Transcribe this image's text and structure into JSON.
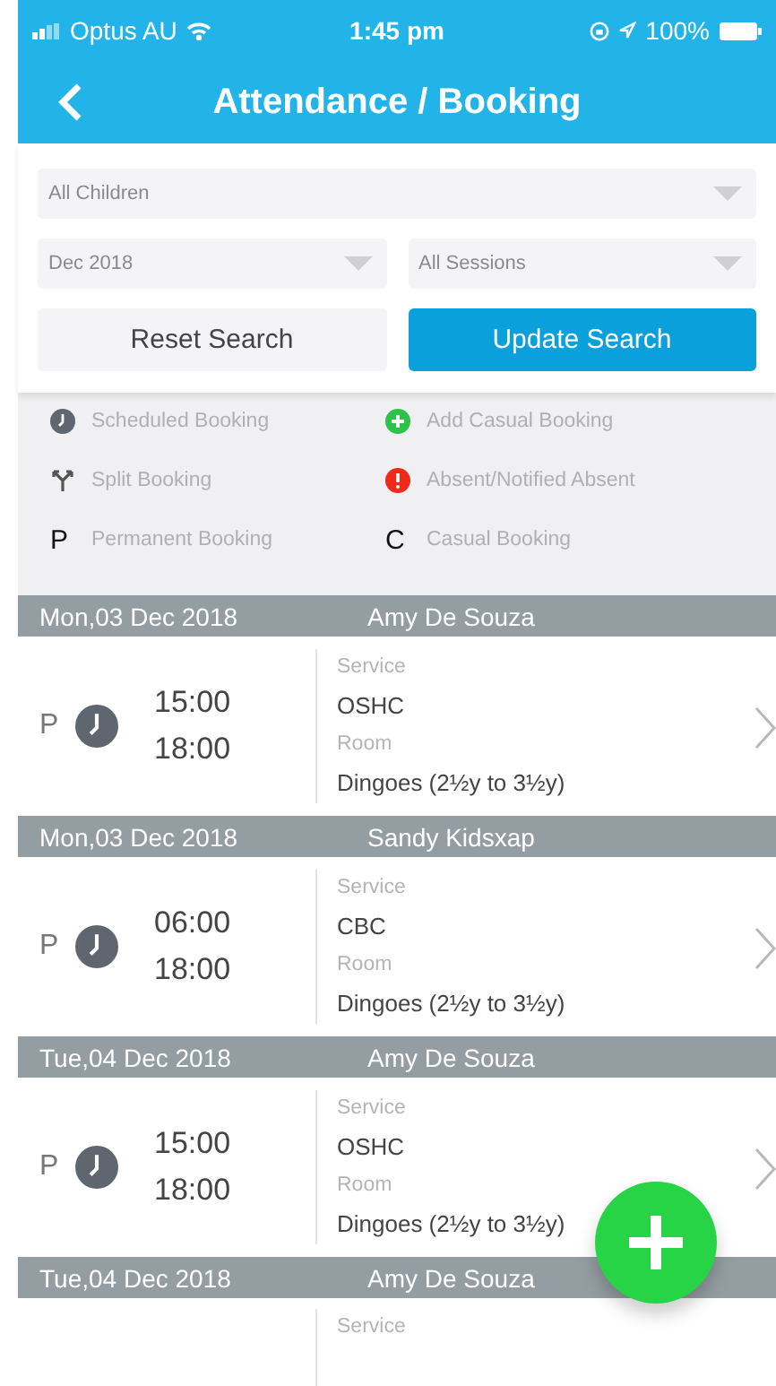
{
  "status_bar": {
    "carrier": "Optus AU",
    "time": "1:45 pm",
    "battery": "100%"
  },
  "header": {
    "title": "Attendance / Booking"
  },
  "filters": {
    "children": "All Children",
    "month": "Dec 2018",
    "sessions": "All Sessions"
  },
  "buttons": [
    {
      "label": "Reset Search",
      "kind": "secondary"
    },
    {
      "label": "Update Search",
      "kind": "primary"
    }
  ],
  "legend": [
    {
      "kind": "clock",
      "label": "Scheduled Booking"
    },
    {
      "kind": "add",
      "label": "Add Casual Booking"
    },
    {
      "kind": "split",
      "label": "Split Booking"
    },
    {
      "kind": "absent",
      "label": "Absent/Notified Absent"
    },
    {
      "kind": "letter",
      "mark": "P",
      "label": "Permanent Booking"
    },
    {
      "kind": "letter",
      "mark": "C",
      "label": "Casual Booking"
    }
  ],
  "bookings": [
    {
      "date": "Mon,03 Dec 2018",
      "child": "Amy De Souza",
      "type": "P",
      "start": "15:00",
      "end": "18:00",
      "service_label": "Service",
      "service": "OSHC",
      "room_label": "Room",
      "room": "Dingoes (2½y to 3½y)"
    },
    {
      "date": "Mon,03 Dec 2018",
      "child": "Sandy Kidsxap",
      "type": "P",
      "start": "06:00",
      "end": "18:00",
      "service_label": "Service",
      "service": "CBC",
      "room_label": "Room",
      "room": "Dingoes (2½y to 3½y)"
    },
    {
      "date": "Tue,04 Dec 2018",
      "child": "Amy De Souza",
      "type": "P",
      "start": "15:00",
      "end": "18:00",
      "service_label": "Service",
      "service": "OSHC",
      "room_label": "Room",
      "room": "Dingoes (2½y to 3½y)"
    },
    {
      "date": "Tue,04 Dec 2018",
      "child": "Amy De Souza",
      "service_label": "Service"
    }
  ]
}
